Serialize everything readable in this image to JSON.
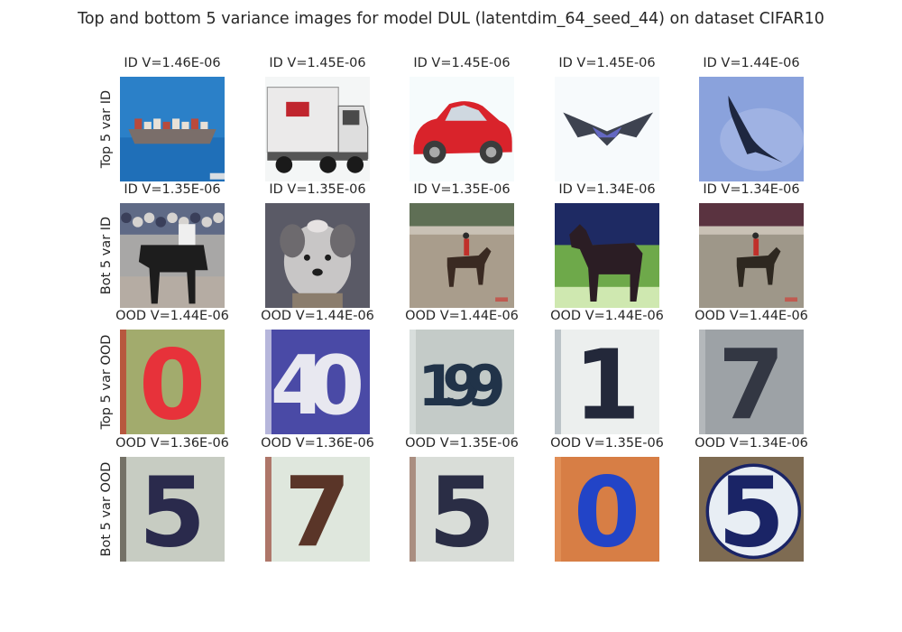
{
  "chart_data": {
    "type": "image-grid",
    "title": "Top and bottom 5 variance images for model DUL (latentdim_64_seed_44) on dataset CIFAR10",
    "rows": [
      {
        "label": "Top 5 var ID",
        "items": [
          {
            "caption": "ID V=1.46E-06",
            "variance": 1.46e-06,
            "icon": "cargo-ship-image",
            "colors": {
              "bg": "#2b80c8",
              "main": "#7a6e6a",
              "accent": "#e8e0d6"
            }
          },
          {
            "caption": "ID V=1.45E-06",
            "variance": 1.45e-06,
            "icon": "truck-image",
            "colors": {
              "bg": "#f4f6f6",
              "main": "#ebeaea",
              "accent": "#c0252e"
            }
          },
          {
            "caption": "ID V=1.45E-06",
            "variance": 1.45e-06,
            "icon": "red-car-image",
            "colors": {
              "bg": "#f6fbfc",
              "main": "#d9232b",
              "accent": "#3c3c3c"
            }
          },
          {
            "caption": "ID V=1.45E-06",
            "variance": 1.45e-06,
            "icon": "stealth-plane-image",
            "colors": {
              "bg": "#f7fafc",
              "main": "#3e4350",
              "accent": "#6468c2"
            }
          },
          {
            "caption": "ID V=1.44E-06",
            "variance": 1.44e-06,
            "icon": "bird-in-sky-image",
            "colors": {
              "bg": "#8aa2dc",
              "main": "#1e2740",
              "accent": "#c6d1f0"
            }
          }
        ]
      },
      {
        "label": "Bot 5 var ID",
        "items": [
          {
            "caption": "ID V=1.35E-06",
            "variance": 1.35e-06,
            "icon": "horse-and-crowd-image",
            "colors": {
              "bg": "#a8a7a6",
              "main": "#1d1d1d",
              "accent": "#5f6a86"
            }
          },
          {
            "caption": "ID V=1.35E-06",
            "variance": 1.35e-06,
            "icon": "dog-image",
            "colors": {
              "bg": "#5a5a66",
              "main": "#c8c6c6",
              "accent": "#8b7d6d"
            }
          },
          {
            "caption": "ID V=1.35E-06",
            "variance": 1.35e-06,
            "icon": "horse-rider-image",
            "colors": {
              "bg": "#a99d8c",
              "main": "#3a2a22",
              "accent": "#5f6f55"
            }
          },
          {
            "caption": "ID V=1.34E-06",
            "variance": 1.34e-06,
            "icon": "dark-horse-image",
            "colors": {
              "bg": "#6ea94a",
              "main": "#2b1d24",
              "accent": "#1e2a63"
            }
          },
          {
            "caption": "ID V=1.34E-06",
            "variance": 1.34e-06,
            "icon": "horse-rider-image",
            "colors": {
              "bg": "#9e9789",
              "main": "#2e2820",
              "accent": "#5a3340"
            }
          }
        ]
      },
      {
        "label": "Top 5 var OOD",
        "items": [
          {
            "caption": "OOD V=1.44E-06",
            "variance": 1.44e-06,
            "icon": "digit-image",
            "digits": "0",
            "colors": {
              "bg": "#a2ab6d",
              "main": "#e7323a",
              "accent": "#c5201f"
            }
          },
          {
            "caption": "OOD V=1.44E-06",
            "variance": 1.44e-06,
            "icon": "digit-image",
            "digits": "40",
            "colors": {
              "bg": "#4a4aa6",
              "main": "#e8e8f0",
              "accent": "#ffffff"
            }
          },
          {
            "caption": "OOD V=1.44E-06",
            "variance": 1.44e-06,
            "icon": "digit-image",
            "digits": "199",
            "colors": {
              "bg": "#c4cbc8",
              "main": "#213349",
              "accent": "#e6ebea"
            }
          },
          {
            "caption": "OOD V=1.44E-06",
            "variance": 1.44e-06,
            "icon": "digit-image",
            "digits": "1",
            "colors": {
              "bg": "#ecefee",
              "main": "#23283a",
              "accent": "#9aa4ad"
            }
          },
          {
            "caption": "OOD V=1.44E-06",
            "variance": 1.44e-06,
            "icon": "digit-image",
            "digits": "7",
            "colors": {
              "bg": "#9da2a6",
              "main": "#333743",
              "accent": "#c3c7ca"
            }
          }
        ]
      },
      {
        "label": "Bot 5 var OOD",
        "items": [
          {
            "caption": "OOD V=1.36E-06",
            "variance": 1.36e-06,
            "icon": "digit-image",
            "digits": "5",
            "colors": {
              "bg": "#c7ccc2",
              "main": "#2a2a4c",
              "accent": "#3c3428"
            }
          },
          {
            "caption": "OOD V=1.36E-06",
            "variance": 1.36e-06,
            "icon": "digit-image",
            "digits": "7",
            "colors": {
              "bg": "#dfe7dd",
              "main": "#5a3528",
              "accent": "#8e2c1c"
            }
          },
          {
            "caption": "OOD V=1.35E-06",
            "variance": 1.35e-06,
            "icon": "digit-image",
            "digits": "5",
            "colors": {
              "bg": "#d9ddd8",
              "main": "#2a2d45",
              "accent": "#8a5a48"
            }
          },
          {
            "caption": "OOD V=1.35E-06",
            "variance": 1.35e-06,
            "icon": "digit-image",
            "digits": "0",
            "colors": {
              "bg": "#d77e45",
              "main": "#2244c7",
              "accent": "#e89a63"
            }
          },
          {
            "caption": "OOD V=1.34E-06",
            "variance": 1.34e-06,
            "icon": "digit-in-circle-image",
            "digits": "5",
            "colors": {
              "bg": "#7e6b52",
              "main": "#1a2466",
              "accent": "#e8eef4"
            }
          }
        ]
      }
    ]
  }
}
